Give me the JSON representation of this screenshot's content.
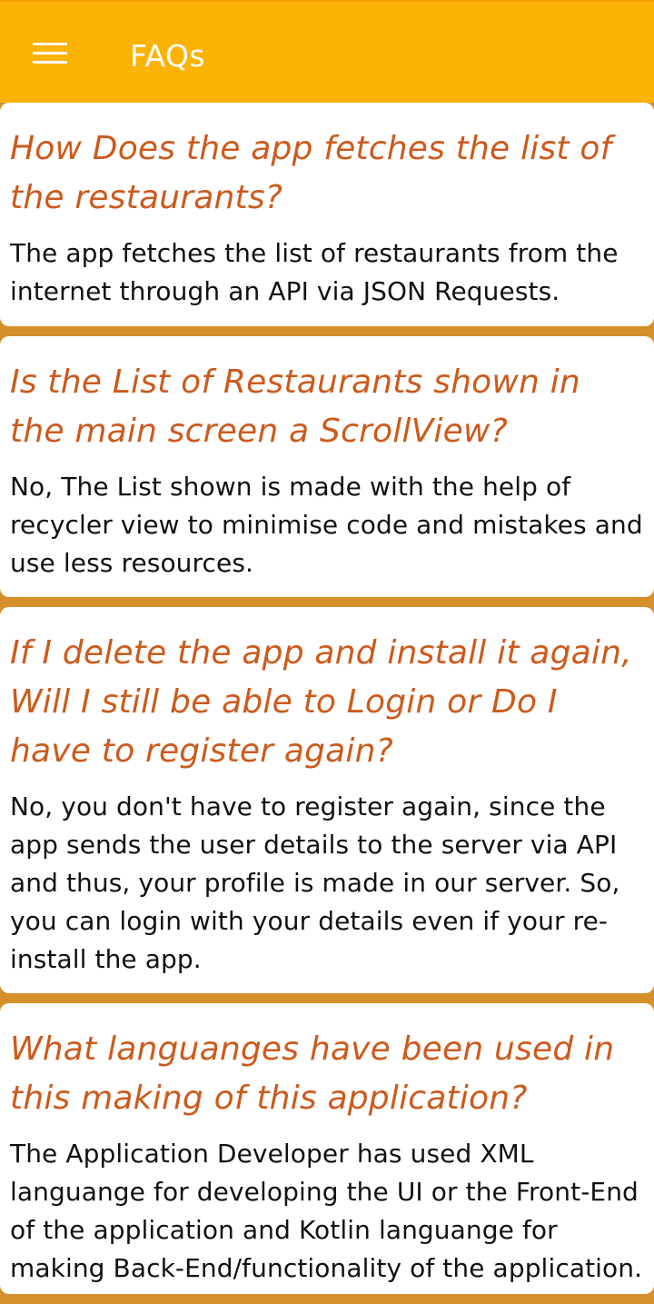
{
  "appbar": {
    "title": "FAQs"
  },
  "faqs": [
    {
      "question": "How Does the app fetches the list of the restaurants?",
      "answer": "The app fetches the list of restaurants from the internet through an API via JSON Requests."
    },
    {
      "question": "Is the List of Restaurants shown in the main screen a ScrollView?",
      "answer": "No, The List shown is made with the help of recycler view to minimise code and mistakes and use less resources."
    },
    {
      "question": "If I delete the app and install it again, Will I still be able to Login or Do I have to register again?",
      "answer": "No, you don't have to register again, since the app sends the user details to the server via API and thus, your profile is made in our server. So, you can login with your details even if your re-install the app."
    },
    {
      "question": "What languanges have been used in this making of this application?",
      "answer": "The Application Developer has used XML languange for developing the UI or the Front-End of the application and Kotlin languange for making Back-End/functionality of the application."
    }
  ],
  "colors": {
    "appbar": "#fbb305",
    "background": "#d6902b",
    "question_text": "#cc5a1c",
    "answer_text": "#111111"
  }
}
